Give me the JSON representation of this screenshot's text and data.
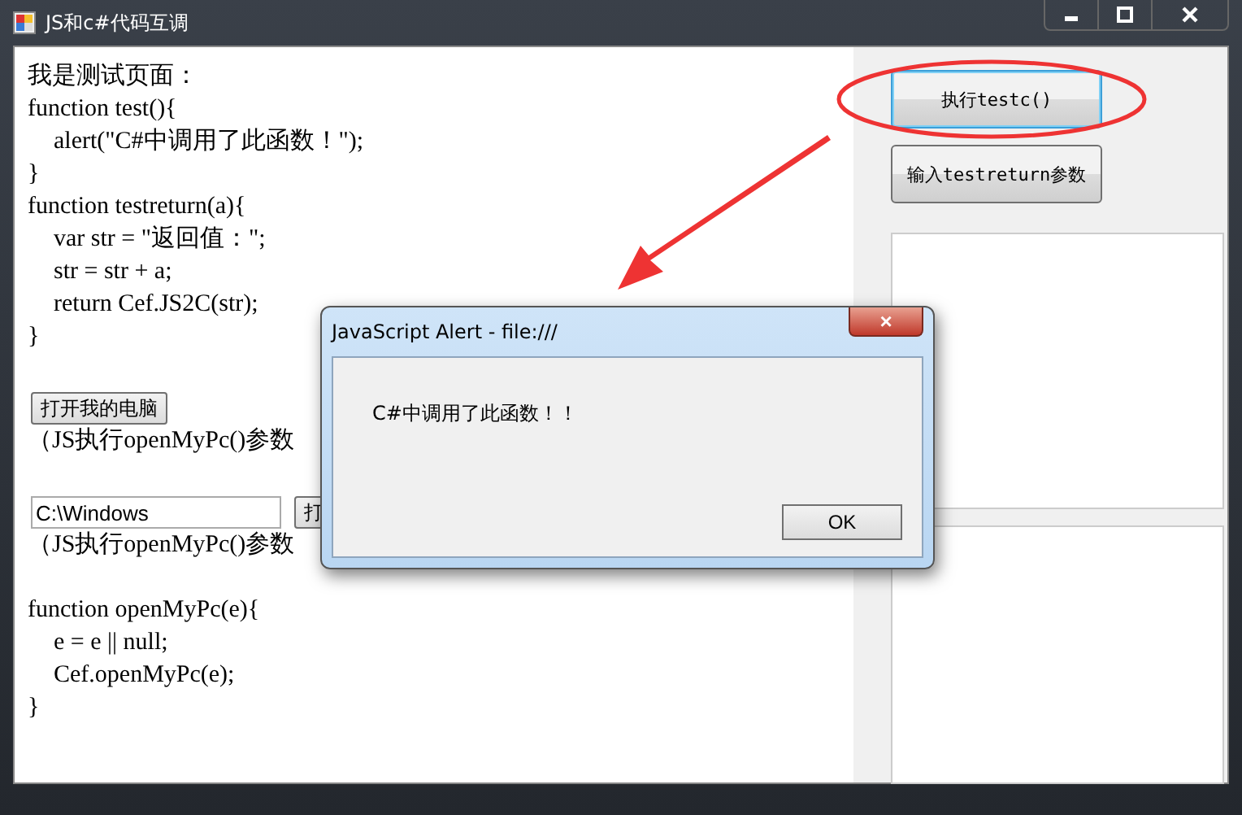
{
  "window": {
    "title": "JS和c#代码互调"
  },
  "page": {
    "heading": "我是测试页面：",
    "functions_top": [
      {
        "header": "function test(){",
        "body": [
          "alert(\"C#中调用了此函数！\");"
        ],
        "footer": "}"
      },
      {
        "header": "function testreturn(a){",
        "body": [
          "var str = \"返回值：\";",
          "str = str + a;",
          "return Cef.JS2C(str);"
        ],
        "footer": "}"
      }
    ],
    "open_button": "打开我的电脑",
    "note_1": "（JS执行openMyPc()参数",
    "path_field": {
      "value": "C:\\Windows"
    },
    "path_button": "打",
    "note_2": "（JS执行openMyPc()参数",
    "functions_bottom": [
      {
        "header": "function openMyPc(e){",
        "body": [
          "e = e || null;",
          "Cef.openMyPc(e);"
        ],
        "footer": "}"
      }
    ]
  },
  "side": {
    "buttons": [
      {
        "label": "执行testc()",
        "focused": true
      },
      {
        "label": "输入testreturn参数",
        "focused": false
      }
    ]
  },
  "dialog": {
    "title": "JavaScript Alert - file:///",
    "close": "×",
    "message": "C#中调用了此函数！！",
    "ok": "OK"
  }
}
